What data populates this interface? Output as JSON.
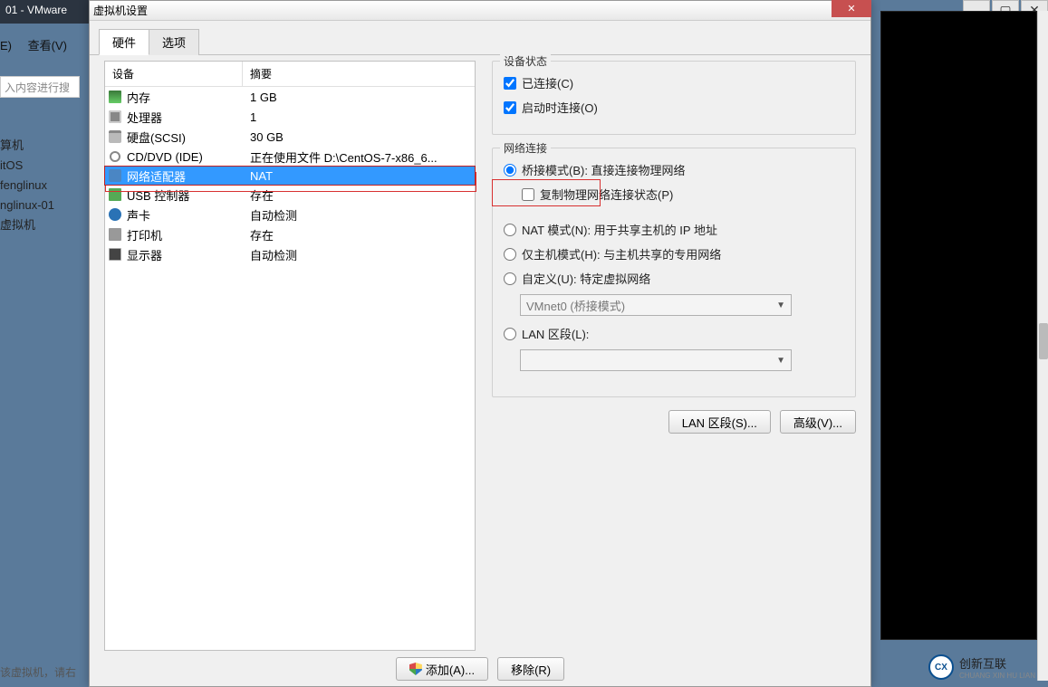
{
  "bg": {
    "title": "01 - VMware",
    "menu1": "E)",
    "menu2": "查看(V)",
    "search_placeholder": "入内容进行搜",
    "tree": [
      "算机",
      "itOS",
      "fenglinux",
      "nglinux-01",
      "虚拟机"
    ],
    "status": "该虚拟机，请右"
  },
  "dialog": {
    "title": "虚拟机设置",
    "tabs": {
      "hardware": "硬件",
      "options": "选项"
    },
    "col_device": "设备",
    "col_summary": "摘要",
    "devices": [
      {
        "icon": "mem",
        "name": "内存",
        "summary": "1 GB"
      },
      {
        "icon": "cpu",
        "name": "处理器",
        "summary": "1"
      },
      {
        "icon": "hdd",
        "name": "硬盘(SCSI)",
        "summary": "30 GB"
      },
      {
        "icon": "cd",
        "name": "CD/DVD (IDE)",
        "summary": "正在使用文件 D:\\CentOS-7-x86_6..."
      },
      {
        "icon": "net",
        "name": "网络适配器",
        "summary": "NAT",
        "selected": true
      },
      {
        "icon": "usb",
        "name": "USB 控制器",
        "summary": "存在"
      },
      {
        "icon": "snd",
        "name": "声卡",
        "summary": "自动检测"
      },
      {
        "icon": "prn",
        "name": "打印机",
        "summary": "存在"
      },
      {
        "icon": "disp",
        "name": "显示器",
        "summary": "自动检测"
      }
    ],
    "status_group": "设备状态",
    "connected": "已连接(C)",
    "connect_on_power": "启动时连接(O)",
    "net_group": "网络连接",
    "bridge": "桥接模式(B): 直接连接物理网络",
    "replicate": "复制物理网络连接状态(P)",
    "nat": "NAT 模式(N): 用于共享主机的 IP 地址",
    "hostonly": "仅主机模式(H): 与主机共享的专用网络",
    "custom": "自定义(U): 特定虚拟网络",
    "custom_select": "VMnet0 (桥接模式)",
    "lan": "LAN 区段(L):",
    "lan_select": "",
    "btn_lan": "LAN 区段(S)...",
    "btn_adv": "高级(V)...",
    "btn_add": "添加(A)...",
    "btn_remove": "移除(R)"
  },
  "brand": {
    "text": "创新互联",
    "sub": "CHUANG XIN HU LIAN"
  }
}
